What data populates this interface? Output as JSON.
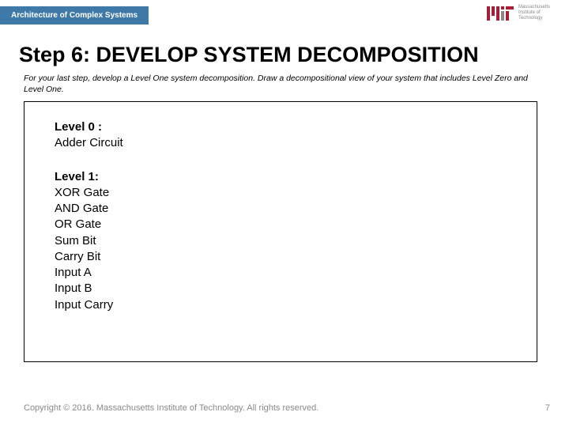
{
  "header": {
    "tab_label": "Architecture of Complex Systems"
  },
  "logo": {
    "institution_line1": "Massachusetts",
    "institution_line2": "Institute of",
    "institution_line3": "Technology"
  },
  "title": "Step 6: DEVELOP SYSTEM DECOMPOSITION",
  "instructions": "For your last step, develop a Level One system decomposition. Draw a decompositional view of your system that includes Level Zero and Level One.",
  "content": {
    "level0": {
      "label": "Level 0 :",
      "name": "Adder Circuit"
    },
    "level1": {
      "label": "Level 1:",
      "items": [
        "XOR Gate",
        "AND Gate",
        "OR Gate",
        "Sum Bit",
        "Carry Bit",
        "Input A",
        "Input B",
        "Input Carry"
      ]
    }
  },
  "footer": {
    "copyright": "Copyright © 2016. Massachusetts Institute of Technology. All rights reserved.",
    "page_number": "7"
  }
}
